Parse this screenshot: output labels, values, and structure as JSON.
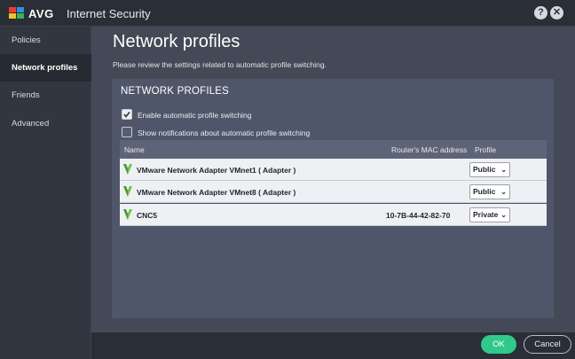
{
  "window": {
    "brand": "AVG",
    "title": "Internet Security",
    "help_label": "?",
    "close_label": "✕"
  },
  "sidebar": {
    "items": [
      {
        "label": "Policies",
        "active": false
      },
      {
        "label": "Network profiles",
        "active": true
      },
      {
        "label": "Friends",
        "active": false
      },
      {
        "label": "Advanced",
        "active": false
      }
    ]
  },
  "main": {
    "title": "Network profiles",
    "description": "Please review the settings related to automatic profile switching.",
    "panel": {
      "title": "NETWORK PROFILES",
      "options": [
        {
          "label": "Enable automatic profile switching",
          "checked": true
        },
        {
          "label": "Show notifications about automatic profile switching",
          "checked": false
        }
      ],
      "table": {
        "columns": [
          "Name",
          "Router's MAC address",
          "Profile"
        ],
        "rows": [
          {
            "name": "VMware Network Adapter VMnet1 ( Adapter )",
            "mac": "",
            "profile": "Public",
            "icon": "network-adapter-icon"
          },
          {
            "name": "VMware Network Adapter VMnet8 ( Adapter )",
            "mac": "",
            "profile": "Public",
            "icon": "network-adapter-icon"
          },
          {
            "name": "CNC5",
            "mac": "10-7B-44-42-82-70",
            "profile": "Private",
            "icon": "network-adapter-icon"
          }
        ]
      }
    }
  },
  "footer": {
    "ok_label": "OK",
    "cancel_label": "Cancel"
  },
  "colors": {
    "accent_green": "#2fc98a",
    "sidebar_active_bg": "#262a32",
    "panel_bg": "#50566a",
    "table_row_bg": "#eff0f3"
  }
}
